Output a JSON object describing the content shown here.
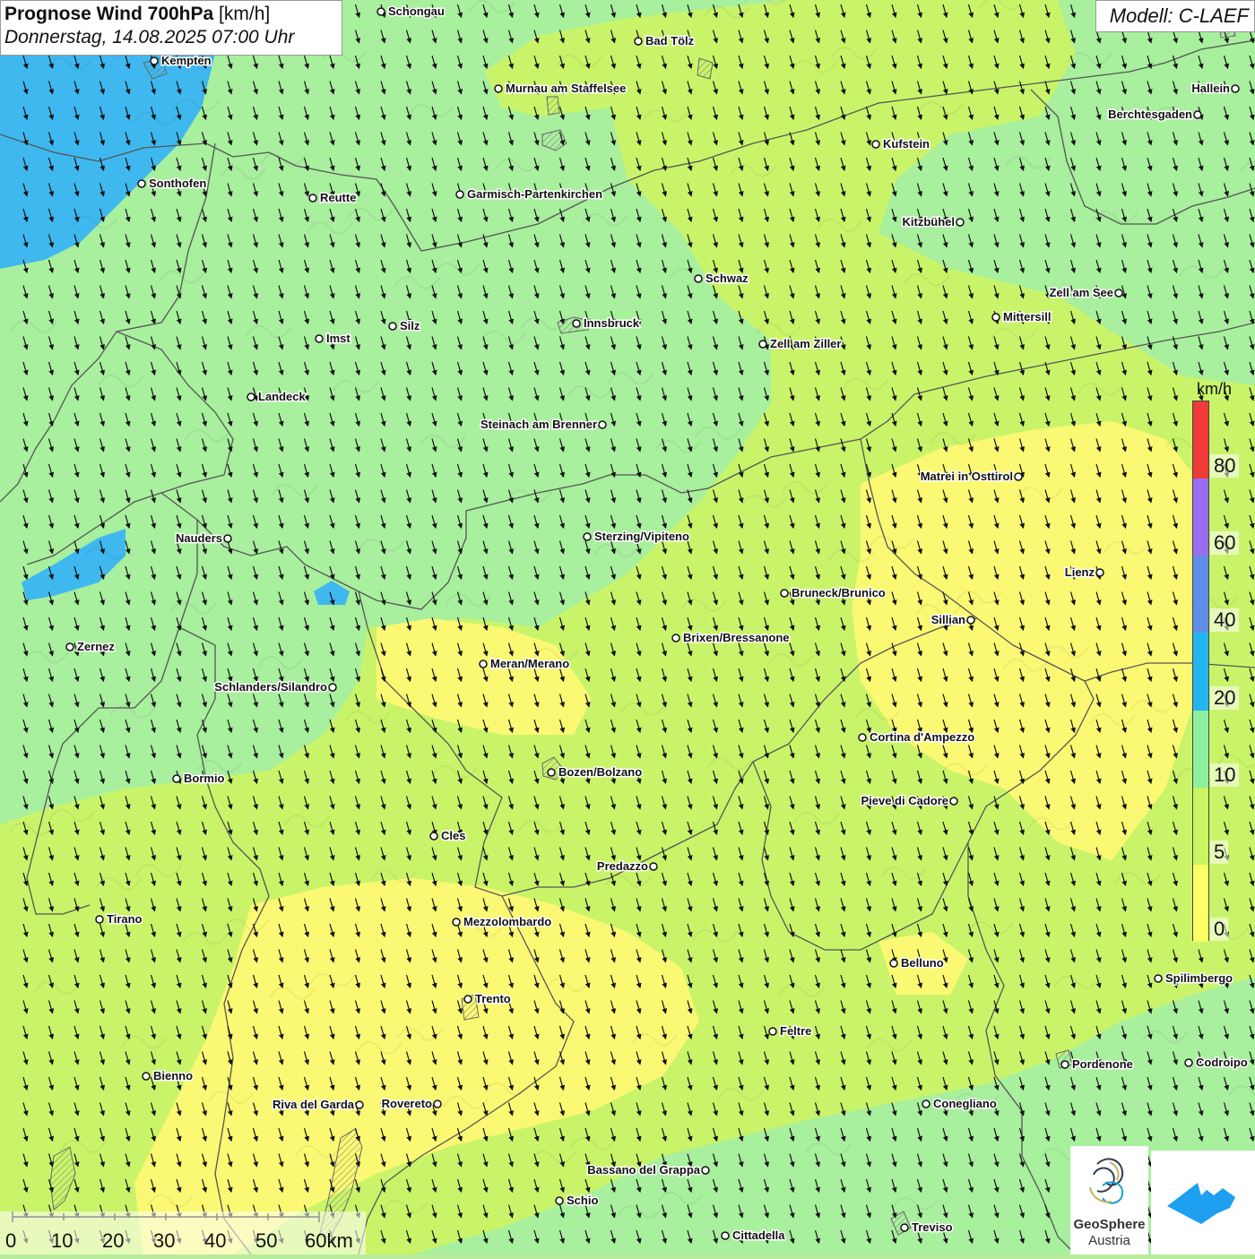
{
  "header": {
    "title_bold": "Prognose Wind 700hPa",
    "title_unit": "[km/h]",
    "datetime": "Donnerstag, 14.08.2025 07:00 Uhr"
  },
  "model_label": "Modell: C-LAEF",
  "legend": {
    "unit": "km/h",
    "classes": [
      {
        "label": "0",
        "color": "#ffff66"
      },
      {
        "label": "5",
        "color": "#c8f560"
      },
      {
        "label": "10",
        "color": "#8ef09e"
      },
      {
        "label": "20",
        "color": "#22b6f0"
      },
      {
        "label": "40",
        "color": "#5f8ee6"
      },
      {
        "label": "60",
        "color": "#9a6cf0"
      },
      {
        "label": "80",
        "color": "#f03a3a"
      }
    ]
  },
  "scale_bar": {
    "labels": [
      "0",
      "10",
      "20",
      "30",
      "40",
      "50",
      "60km"
    ]
  },
  "cities": [
    {
      "name": "Schongau",
      "label_side": "right"
    },
    {
      "name": "Bad Tölz",
      "label_side": "right"
    },
    {
      "name": "Kempten",
      "label_side": "right"
    },
    {
      "name": "Murnau am Staffelsee",
      "label_side": "right"
    },
    {
      "name": "Hallein",
      "label_side": "left"
    },
    {
      "name": "Berchtesgaden",
      "label_side": "left"
    },
    {
      "name": "Kufstein",
      "label_side": "right"
    },
    {
      "name": "Sonthofen",
      "label_side": "right"
    },
    {
      "name": "Reutte",
      "label_side": "right"
    },
    {
      "name": "Garmisch-Partenkirchen",
      "label_side": "right"
    },
    {
      "name": "Kitzbühel",
      "label_side": "left"
    },
    {
      "name": "Schwaz",
      "label_side": "right"
    },
    {
      "name": "Zell am See",
      "label_side": "left"
    },
    {
      "name": "Mittersill",
      "label_side": "right"
    },
    {
      "name": "Innsbruck",
      "label_side": "right"
    },
    {
      "name": "Silz",
      "label_side": "right"
    },
    {
      "name": "Imst",
      "label_side": "right"
    },
    {
      "name": "Zell am Ziller",
      "label_side": "right"
    },
    {
      "name": "Landeck",
      "label_side": "right"
    },
    {
      "name": "Steinach am Brenner",
      "label_side": "left"
    },
    {
      "name": "Matrei in Osttirol",
      "label_side": "left"
    },
    {
      "name": "Nauders",
      "label_side": "left"
    },
    {
      "name": "Sterzing/Vipiteno",
      "label_side": "right"
    },
    {
      "name": "Lienz",
      "label_side": "left"
    },
    {
      "name": "Bruneck/Brunico",
      "label_side": "right"
    },
    {
      "name": "Sillian",
      "label_side": "left"
    },
    {
      "name": "Brixen/Bressanone",
      "label_side": "right"
    },
    {
      "name": "Zernez",
      "label_side": "right"
    },
    {
      "name": "Meran/Merano",
      "label_side": "right"
    },
    {
      "name": "Schlanders/Silandro",
      "label_side": "left"
    },
    {
      "name": "Cortina d'Ampezzo",
      "label_side": "right"
    },
    {
      "name": "Bozen/Bolzano",
      "label_side": "right"
    },
    {
      "name": "Bormio",
      "label_side": "right"
    },
    {
      "name": "Pieve di Cadore",
      "label_side": "left"
    },
    {
      "name": "Cles",
      "label_side": "right"
    },
    {
      "name": "Predazzo",
      "label_side": "left"
    },
    {
      "name": "Tirano",
      "label_side": "right"
    },
    {
      "name": "Mezzolombardo",
      "label_side": "right"
    },
    {
      "name": "Belluno",
      "label_side": "right"
    },
    {
      "name": "Spilimbergo",
      "label_side": "right"
    },
    {
      "name": "Trento",
      "label_side": "right"
    },
    {
      "name": "Feltre",
      "label_side": "right"
    },
    {
      "name": "Bienno",
      "label_side": "right"
    },
    {
      "name": "Pordenone",
      "label_side": "right"
    },
    {
      "name": "Codroipo",
      "label_side": "right"
    },
    {
      "name": "Riva del Garda",
      "label_side": "left"
    },
    {
      "name": "Rovereto",
      "label_side": "left"
    },
    {
      "name": "Conegliano",
      "label_side": "right"
    },
    {
      "name": "Bassano del Grappa",
      "label_side": "left"
    },
    {
      "name": "Schio",
      "label_side": "right"
    },
    {
      "name": "Treviso",
      "label_side": "right"
    },
    {
      "name": "Cittadella",
      "label_side": "right"
    }
  ],
  "logos": {
    "geosphere_name": "GeoSphere",
    "geosphere_sub": "Austria"
  },
  "wind_direction": "NNW"
}
